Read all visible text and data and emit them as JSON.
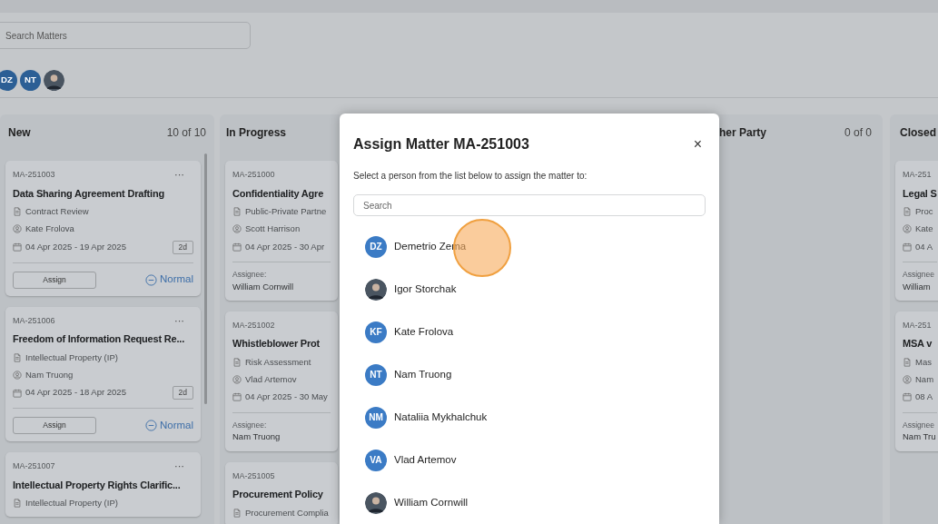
{
  "search": {
    "placeholder": "Search Matters"
  },
  "filter_avatars": [
    {
      "kind": "initials",
      "initials": "DZ"
    },
    {
      "kind": "initials",
      "initials": "NT"
    },
    {
      "kind": "photo"
    }
  ],
  "columns": [
    {
      "title": "New",
      "count": "10 of 10",
      "scrollbar": true,
      "cards": [
        {
          "kind": "open",
          "id": "MA-251003",
          "menu": "···",
          "title": "Data Sharing Agreement Drafting",
          "type": "Contract Review",
          "person": "Kate Frolova",
          "dates": "04 Apr 2025 - 19 Apr 2025",
          "duration": "2d",
          "action": "Assign",
          "priority": "Normal"
        },
        {
          "kind": "open",
          "id": "MA-251006",
          "menu": "···",
          "title": "Freedom of Information Request Re...",
          "type": "Intellectual Property (IP)",
          "person": "Nam Truong",
          "dates": "04 Apr 2025 - 18 Apr 2025",
          "duration": "2d",
          "action": "Assign",
          "priority": "Normal"
        },
        {
          "kind": "open",
          "id": "MA-251007",
          "menu": "···",
          "title": "Intellectual Property Rights Clarific...",
          "type": "Intellectual Property (IP)"
        }
      ]
    },
    {
      "title": "In Progress",
      "cards": [
        {
          "kind": "assigned",
          "id": "MA-251000",
          "title": "Confidentiality Agre",
          "type": "Public-Private Partne",
          "person": "Scott Harrison",
          "dates": "04 Apr 2025 - 30 Apr",
          "assignee_label": "Assignee:",
          "assignee": "William Cornwill"
        },
        {
          "kind": "assigned",
          "id": "MA-251002",
          "title": "Whistleblower Prot",
          "type": "Risk Assessment",
          "person": "Vlad Artemov",
          "dates": "04 Apr 2025 - 30 May",
          "assignee_label": "Assignee:",
          "assignee": "Nam Truong"
        },
        {
          "kind": "assigned",
          "id": "MA-251005",
          "title": "Procurement Policy",
          "type": "Procurement Complia"
        }
      ]
    },
    {
      "title": "her Party",
      "count": "0 of 0"
    },
    {
      "title": "Closed",
      "cards": [
        {
          "kind": "assigned",
          "id": "MA-251",
          "title": "Legal S",
          "type": "Proc",
          "person": "Kate",
          "dates": "04 A",
          "assignee_label": "Assignee",
          "assignee": "William"
        },
        {
          "kind": "assigned",
          "id": "MA-251",
          "title": "MSA v",
          "type": "Mas",
          "person": "Nam",
          "dates": "08 A",
          "assignee_label": "Assignee",
          "assignee": "Nam Tru"
        }
      ]
    }
  ],
  "dialog": {
    "title": "Assign Matter MA-251003",
    "close": "×",
    "instruction": "Select a person from the list below to assign the matter to:",
    "search": {
      "placeholder": "Search"
    },
    "people": [
      {
        "kind": "initials",
        "initials": "DZ",
        "name": "Demetrio Zema"
      },
      {
        "kind": "photo",
        "name": "Igor Storchak"
      },
      {
        "kind": "initials",
        "initials": "KF",
        "name": "Kate Frolova"
      },
      {
        "kind": "initials",
        "initials": "NT",
        "name": "Nam Truong"
      },
      {
        "kind": "initials",
        "initials": "NM",
        "name": "Nataliia Mykhalchuk"
      },
      {
        "kind": "initials",
        "initials": "VA",
        "name": "Vlad Artemov"
      },
      {
        "kind": "photo",
        "name": "William Cornwill"
      }
    ],
    "click_marker": true
  }
}
